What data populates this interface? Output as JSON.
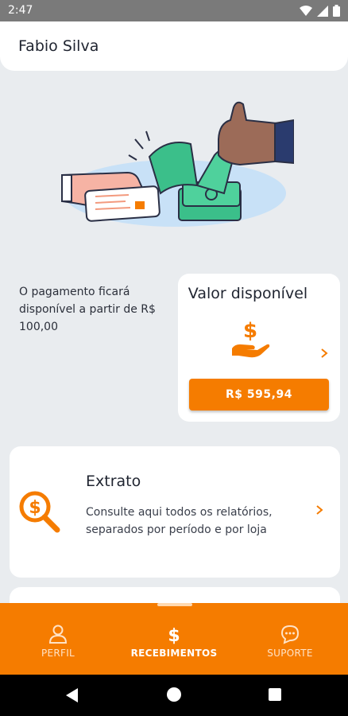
{
  "status_bar": {
    "time": "2:47"
  },
  "header": {
    "user_name": "Fabio Silva"
  },
  "info": {
    "text": "O pagamento ficará disponível a partir de R$ 100,00"
  },
  "balance_card": {
    "title": "Valor disponível",
    "button_label": "R$ 595,94"
  },
  "extrato_card": {
    "title": "Extrato",
    "description": "Consulte aqui todos os relatórios, separados por período e por loja"
  },
  "bottom_nav": {
    "items": [
      {
        "label": "PERFIL",
        "icon": "person-icon"
      },
      {
        "label": "RECEBIMENTOS",
        "icon": "dollar-icon"
      },
      {
        "label": "SUPORTE",
        "icon": "chat-icon"
      }
    ]
  },
  "colors": {
    "accent": "#f57c00",
    "background": "#e9ecef",
    "card": "#ffffff",
    "text": "#1f2430"
  }
}
